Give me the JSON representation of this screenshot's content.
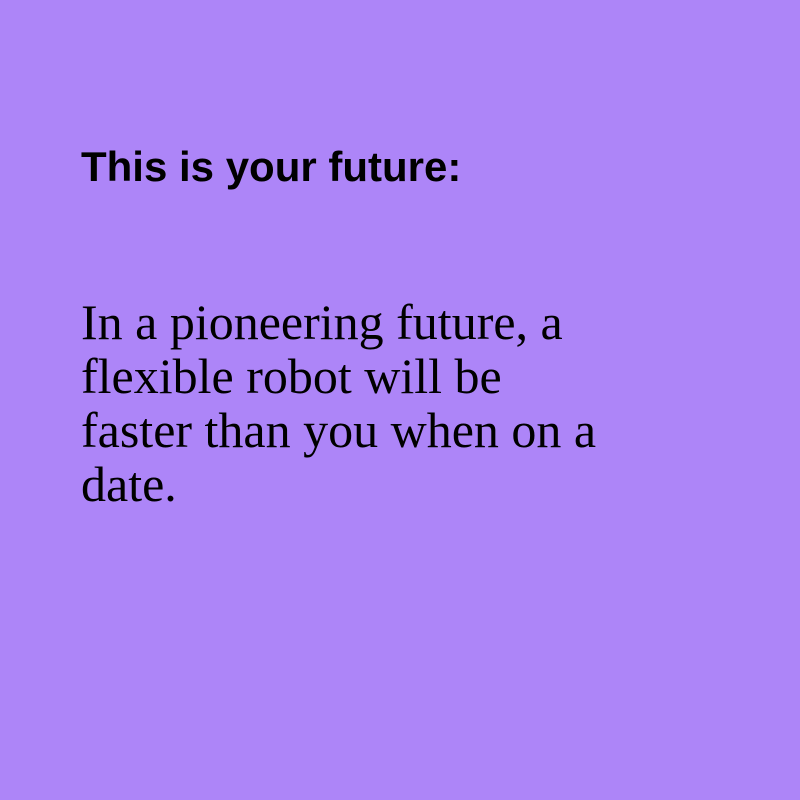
{
  "colors": {
    "background": "#ad85f8",
    "text": "#000000"
  },
  "heading": "This is your future:",
  "prediction_lines": [
    "In a pioneering future, a",
    "flexible robot will be",
    "faster than you when on a",
    "date."
  ]
}
